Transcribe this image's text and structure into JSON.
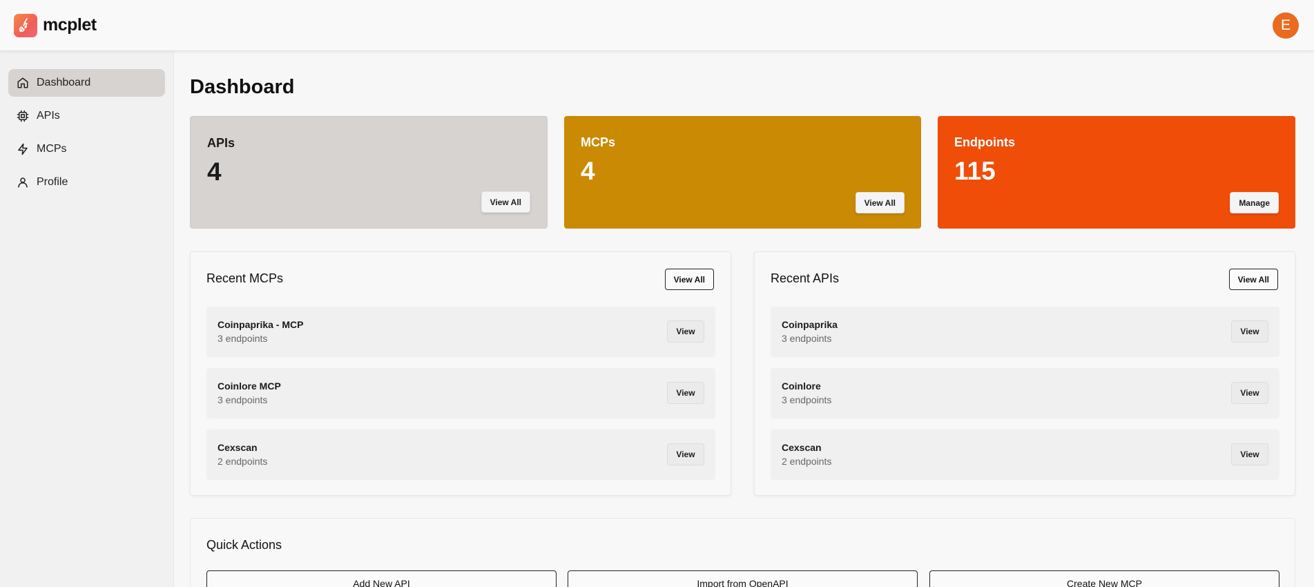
{
  "app": {
    "name": "mcplet",
    "user_initial": "E"
  },
  "sidebar": {
    "items": [
      {
        "label": "Dashboard",
        "icon": "home-icon",
        "active": true
      },
      {
        "label": "APIs",
        "icon": "chip-icon"
      },
      {
        "label": "MCPs",
        "icon": "lightning-icon"
      },
      {
        "label": "Profile",
        "icon": "user-icon"
      }
    ]
  },
  "page": {
    "title": "Dashboard"
  },
  "stats": {
    "apis": {
      "label": "APIs",
      "value": "4",
      "button": "View All",
      "color": "#d6d3d1"
    },
    "mcps": {
      "label": "MCPs",
      "value": "4",
      "button": "View All",
      "color": "#ca8a04"
    },
    "endpoints": {
      "label": "Endpoints",
      "value": "115",
      "button": "Manage",
      "color": "#ef4d08"
    }
  },
  "recent_mcps": {
    "title": "Recent MCPs",
    "view_all": "View All",
    "items": [
      {
        "name": "Coinpaprika - MCP",
        "endpoints": "3 endpoints",
        "button": "View"
      },
      {
        "name": "Coinlore MCP",
        "endpoints": "3 endpoints",
        "button": "View"
      },
      {
        "name": "Cexscan",
        "endpoints": "2 endpoints",
        "button": "View"
      }
    ]
  },
  "recent_apis": {
    "title": "Recent APIs",
    "view_all": "View All",
    "items": [
      {
        "name": "Coinpaprika",
        "endpoints": "3 endpoints",
        "button": "View"
      },
      {
        "name": "Coinlore",
        "endpoints": "3 endpoints",
        "button": "View"
      },
      {
        "name": "Cexscan",
        "endpoints": "2 endpoints",
        "button": "View"
      }
    ]
  },
  "quick_actions": {
    "title": "Quick Actions",
    "buttons": [
      "Add New API",
      "Import from OpenAPI",
      "Create New MCP"
    ]
  }
}
